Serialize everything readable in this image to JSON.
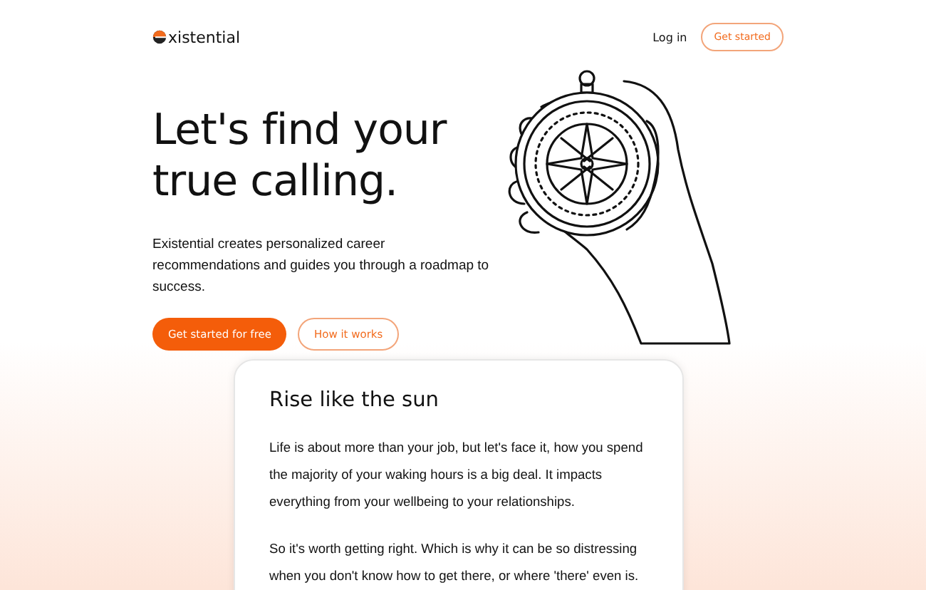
{
  "header": {
    "logo": "xistential",
    "login": "Log in",
    "cta": "Get started"
  },
  "hero": {
    "title_lines": [
      "Let's find your",
      "true calling."
    ],
    "description": "Existential creates personalized career recommendations and guides you through a roadmap to success.",
    "primary_button": "Get started for free",
    "secondary_button": "How it works"
  },
  "card": {
    "title": "Rise like the sun",
    "paragraphs": [
      "Life is about more than your job, but let's face it, how you spend the majority of your waking hours is a big deal. It impacts everything from your wellbeing to your relationships.",
      "So it's worth getting right. Which is why it can be so distressing when you don't know how to get there, or where 'there' even is."
    ]
  }
}
